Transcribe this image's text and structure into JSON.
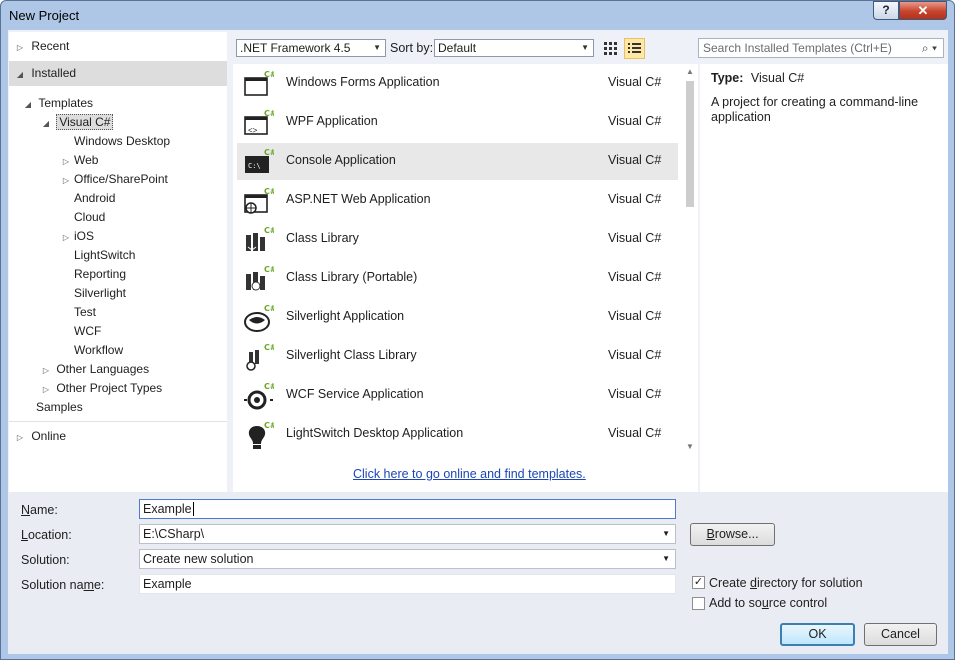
{
  "window": {
    "title": "New Project",
    "help_label": "?",
    "close_label": "✕"
  },
  "left_panel": {
    "recent": "Recent",
    "installed": "Installed",
    "templates": "Templates",
    "visual_csharp": "Visual C#",
    "children": [
      "Windows Desktop",
      "Web",
      "Office/SharePoint",
      "Android",
      "Cloud",
      "iOS",
      "LightSwitch",
      "Reporting",
      "Silverlight",
      "Test",
      "WCF",
      "Workflow"
    ],
    "other_languages": "Other Languages",
    "other_project_types": "Other Project Types",
    "samples": "Samples",
    "online": "Online"
  },
  "toolbar": {
    "framework": ".NET Framework 4.5",
    "sort_label": "Sort by:",
    "sort_value": "Default"
  },
  "search": {
    "placeholder": "Search Installed Templates (Ctrl+E)"
  },
  "templates": [
    {
      "name": "Windows Forms Application",
      "lang": "Visual C#",
      "icon": "windows-forms-icon"
    },
    {
      "name": "WPF Application",
      "lang": "Visual C#",
      "icon": "wpf-icon"
    },
    {
      "name": "Console Application",
      "lang": "Visual C#",
      "icon": "console-icon"
    },
    {
      "name": "ASP.NET Web Application",
      "lang": "Visual C#",
      "icon": "web-app-icon"
    },
    {
      "name": "Class Library",
      "lang": "Visual C#",
      "icon": "class-library-icon"
    },
    {
      "name": "Class Library (Portable)",
      "lang": "Visual C#",
      "icon": "portable-library-icon"
    },
    {
      "name": "Silverlight Application",
      "lang": "Visual C#",
      "icon": "silverlight-icon"
    },
    {
      "name": "Silverlight Class Library",
      "lang": "Visual C#",
      "icon": "silverlight-library-icon"
    },
    {
      "name": "WCF Service Application",
      "lang": "Visual C#",
      "icon": "wcf-icon"
    },
    {
      "name": "LightSwitch Desktop Application",
      "lang": "Visual C#",
      "icon": "lightswitch-icon"
    }
  ],
  "online_link": "Click here to go online and find templates.",
  "info": {
    "type_label": "Type:",
    "type_value": "Visual C#",
    "description": "A project for creating a command-line application"
  },
  "form": {
    "name_label": "Name:",
    "name_value": "Example",
    "location_label": "Location:",
    "location_value": "E:\\CSharp\\",
    "solution_label": "Solution:",
    "solution_value": "Create new solution",
    "solution_name_label": "Solution name:",
    "solution_name_value": "Example",
    "browse_label": "Browse...",
    "create_dir_label": "Create directory for solution",
    "source_control_label": "Add to source control",
    "ok_label": "OK",
    "cancel_label": "Cancel"
  },
  "colors": {
    "accent": "#3c7fb1",
    "link": "#1a46b6",
    "csharp_green": "#68a820"
  }
}
